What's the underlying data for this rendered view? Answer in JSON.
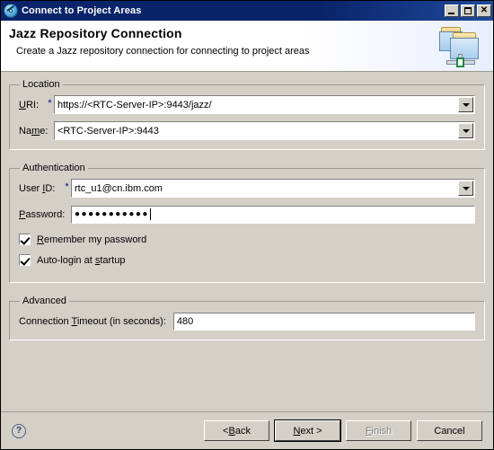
{
  "window": {
    "title": "Connect to Project Areas",
    "title_icon": "jazz-disc-icon",
    "controls": {
      "minimize": "minimize-button",
      "maximize": "maximize-button",
      "close_glyph": "✕"
    }
  },
  "header": {
    "title": "Jazz Repository Connection",
    "description": "Create a Jazz repository connection for connecting to project areas",
    "icon": "repository-connection-icon"
  },
  "location": {
    "legend": "Location",
    "uri": {
      "label_pre": "U",
      "label_mnemonic": "R",
      "label_post": "I:",
      "label_full": "URI:",
      "required_marker": "*",
      "value": "https://<RTC-Server-IP>:9443/jazz/"
    },
    "name": {
      "label_pre": "Na",
      "label_mnemonic": "m",
      "label_post": "e:",
      "label_full": "Name:",
      "value": "<RTC-Server-IP>:9443"
    }
  },
  "authentication": {
    "legend": "Authentication",
    "user_id": {
      "label_pre": "User ",
      "label_mnemonic": "I",
      "label_post": "D:",
      "label_full": "User ID:",
      "required_marker": "*",
      "value": "rtc_u1@cn.ibm.com"
    },
    "password": {
      "label_pre": "",
      "label_mnemonic": "P",
      "label_post": "assword:",
      "label_full": "Password:",
      "value": "●●●●●●●●●●●",
      "masked_char_count": 11
    },
    "remember_password": {
      "label_pre": "",
      "label_mnemonic": "R",
      "label_post": "emember my password",
      "label_full": "Remember my password",
      "checked": true
    },
    "auto_login": {
      "label_pre": "Auto-login at ",
      "label_mnemonic": "s",
      "label_post": "tartup",
      "label_full": "Auto-login at startup",
      "checked": true
    }
  },
  "advanced": {
    "legend": "Advanced",
    "connection_timeout": {
      "label_pre": "Connection ",
      "label_mnemonic": "T",
      "label_post": "imeout (in seconds):",
      "label_full": "Connection Timeout (in seconds):",
      "value": "480"
    }
  },
  "footer": {
    "help_glyph": "?",
    "buttons": [
      {
        "pre": "< ",
        "mnemonic": "B",
        "post": "ack",
        "full": "< Back",
        "state": "enabled",
        "default": false
      },
      {
        "pre": "",
        "mnemonic": "N",
        "post": "ext >",
        "full": "Next >",
        "state": "enabled",
        "default": true
      },
      {
        "pre": "",
        "mnemonic": "F",
        "post": "inish",
        "full": "Finish",
        "state": "disabled",
        "default": false
      },
      {
        "pre": "Cancel",
        "mnemonic": "",
        "post": "",
        "full": "Cancel",
        "state": "enabled",
        "default": false
      }
    ]
  },
  "colors": {
    "dialog_background": "#d4d0c8",
    "titlebar_start": "#0a246a",
    "titlebar_end": "#1e4a9c",
    "header_background": "#ffffff",
    "required_marker": "#00008b",
    "field_background": "#ffffff",
    "disabled_text": "#808080"
  }
}
